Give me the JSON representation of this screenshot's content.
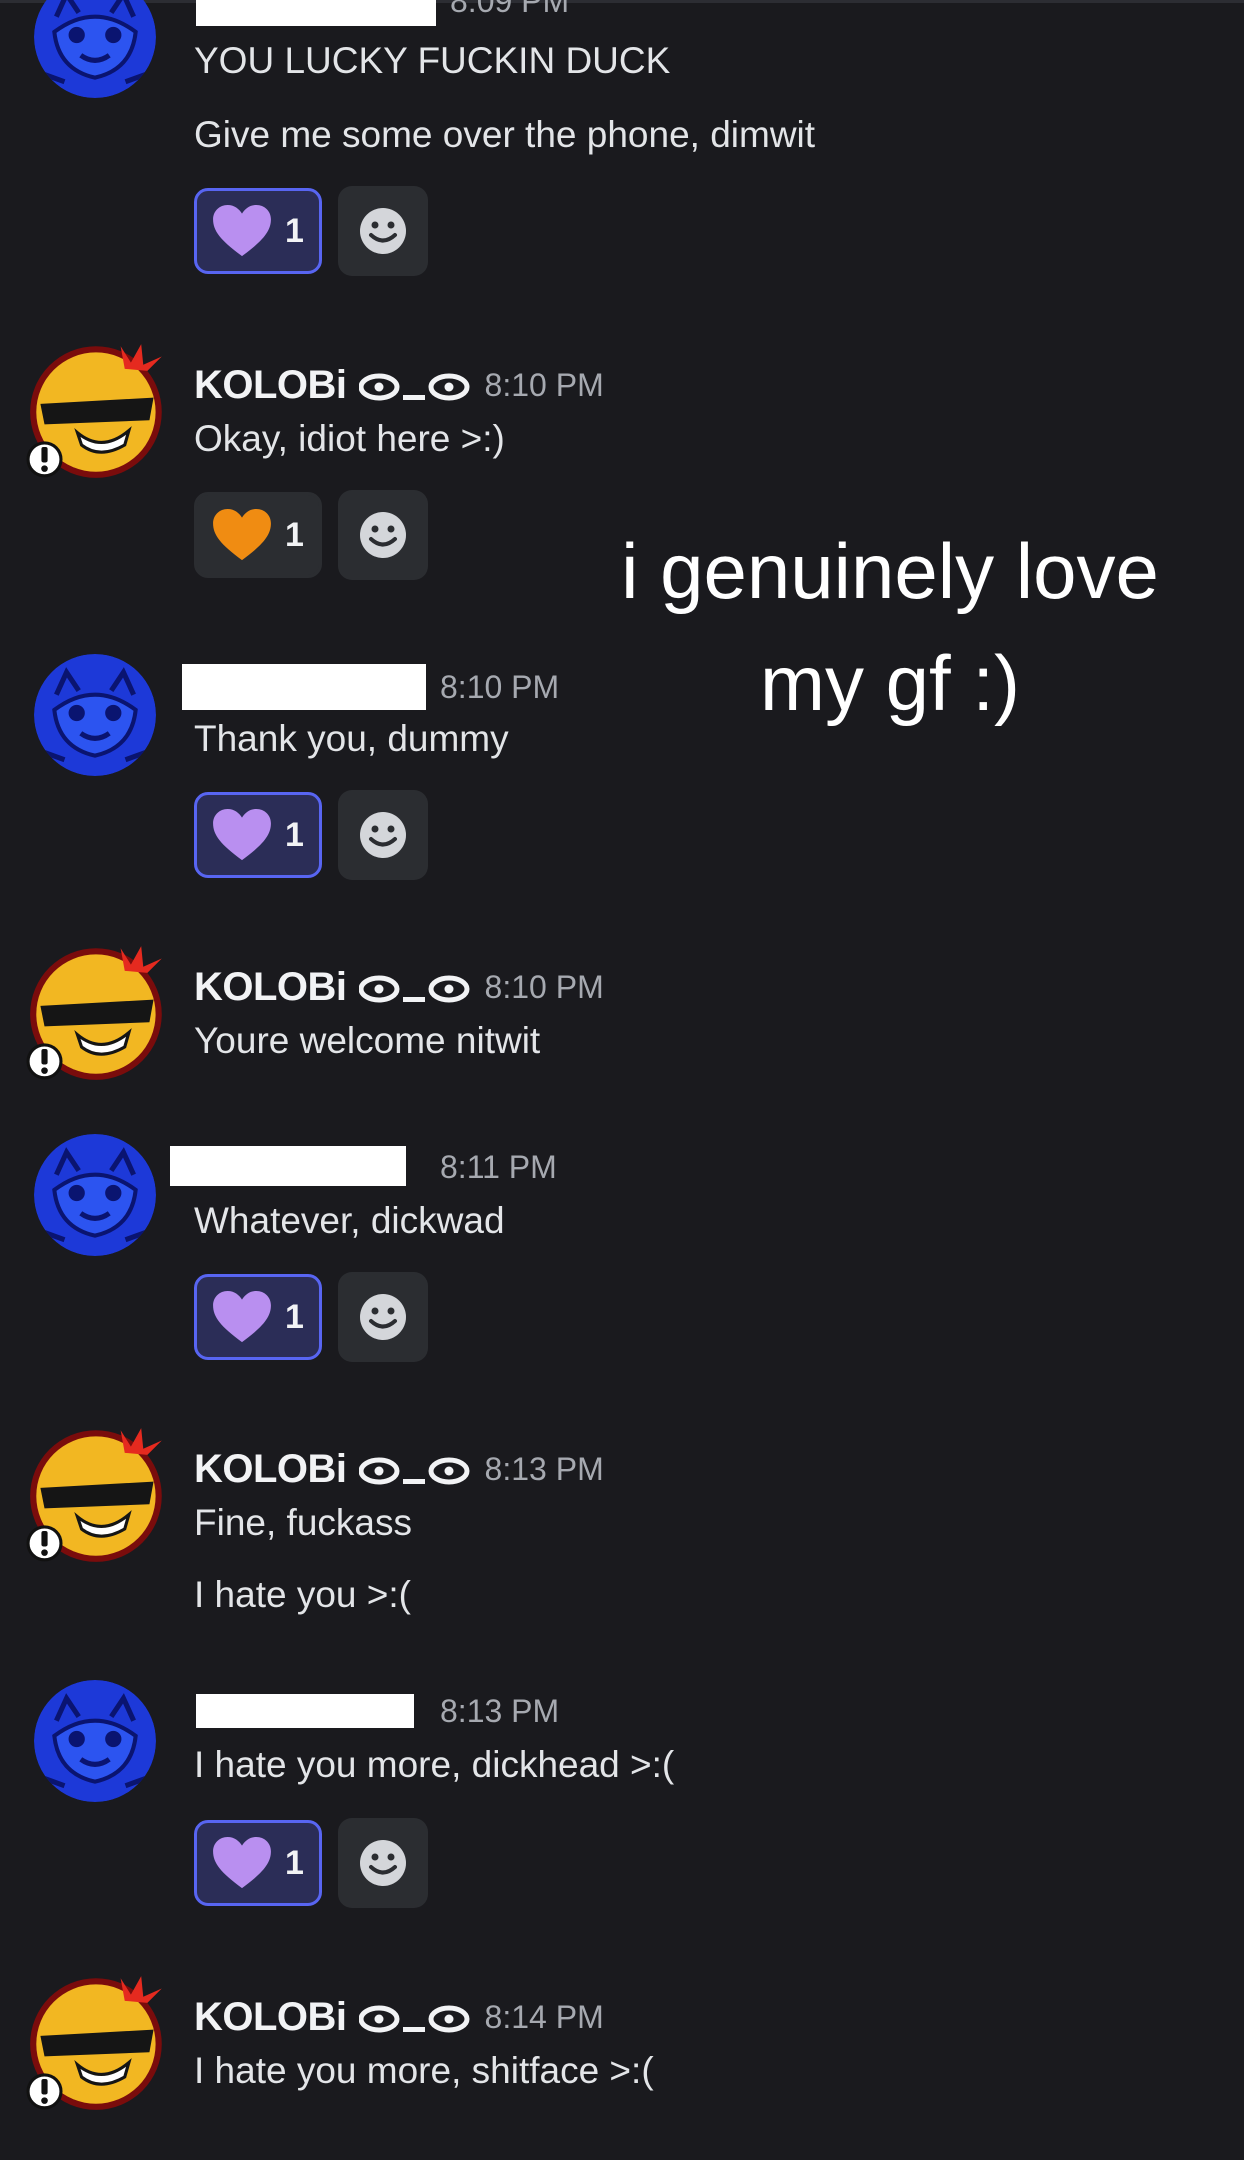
{
  "overlay": {
    "caption": "i genuinely love my gf :)"
  },
  "users": {
    "kolobi": {
      "name": "KOLOBi",
      "tag_icon": "eye-underscore-eye-icon"
    }
  },
  "messages": [
    {
      "time": "8:09 PM",
      "lines": [
        "YOU LUCKY FUCKIN DUCK",
        "Give me some over the phone, dimwit"
      ],
      "reaction": {
        "emoji": "purple-heart",
        "count": "1"
      }
    },
    {
      "time": "8:10 PM",
      "lines": [
        "Okay, idiot here >:)"
      ],
      "reaction": {
        "emoji": "orange-heart",
        "count": "1"
      }
    },
    {
      "time": "8:10 PM",
      "lines": [
        "Thank you, dummy"
      ],
      "reaction": {
        "emoji": "purple-heart",
        "count": "1"
      }
    },
    {
      "time": "8:10 PM",
      "lines": [
        "Youre welcome nitwit"
      ]
    },
    {
      "time": "8:11 PM",
      "lines": [
        "Whatever, dickwad"
      ],
      "reaction": {
        "emoji": "purple-heart",
        "count": "1"
      }
    },
    {
      "time": "8:13 PM",
      "lines": [
        "Fine, fuckass",
        "I hate you >:("
      ]
    },
    {
      "time": "8:13 PM",
      "lines": [
        "I hate you more, dickhead >:("
      ],
      "reaction": {
        "emoji": "purple-heart",
        "count": "1"
      }
    },
    {
      "time": "8:14 PM",
      "lines": [
        "I hate you more, shitface >:("
      ]
    }
  ],
  "colors": {
    "background": "#1a1a1e",
    "purple_heart": "#b98ff0",
    "orange_heart": "#f08c12",
    "reaction_active_border": "#5865f2",
    "avatar_blue": "#1d39d8",
    "avatar_yellow": "#f2b722"
  }
}
